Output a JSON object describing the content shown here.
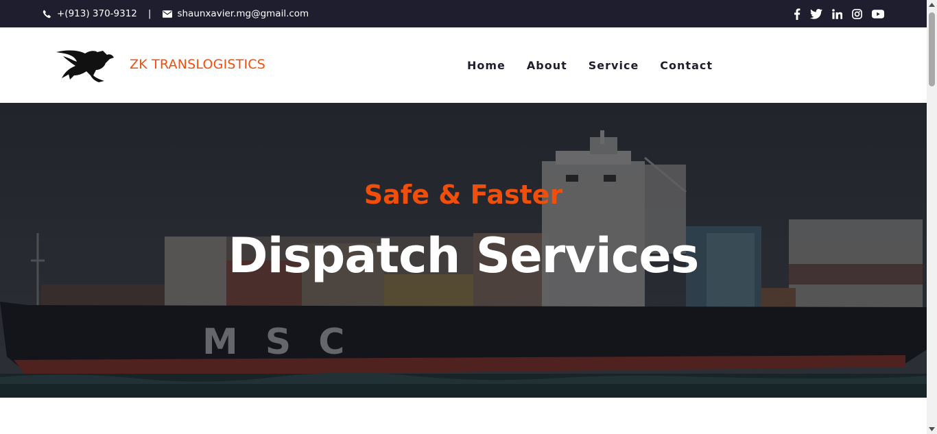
{
  "topbar": {
    "phone": "+(913) 370-9312",
    "separator": "|",
    "email": "shaunxavier.mg@gmail.com",
    "social_icons": [
      "facebook-icon",
      "twitter-icon",
      "linkedin-icon",
      "instagram-icon",
      "youtube-icon"
    ]
  },
  "header": {
    "brand": "ZK TRANSLOGISTICS",
    "logo_icon": "dragon-logo",
    "nav": [
      "Home",
      "About",
      "Service",
      "Contact"
    ]
  },
  "hero": {
    "kicker": "Safe & Faster",
    "headline": "Dispatch Services",
    "ship_text": "MSC"
  },
  "colors": {
    "accent": "#f04e0b",
    "topbar_bg": "#1f1e2e",
    "nav_text": "#1f1e2e"
  }
}
